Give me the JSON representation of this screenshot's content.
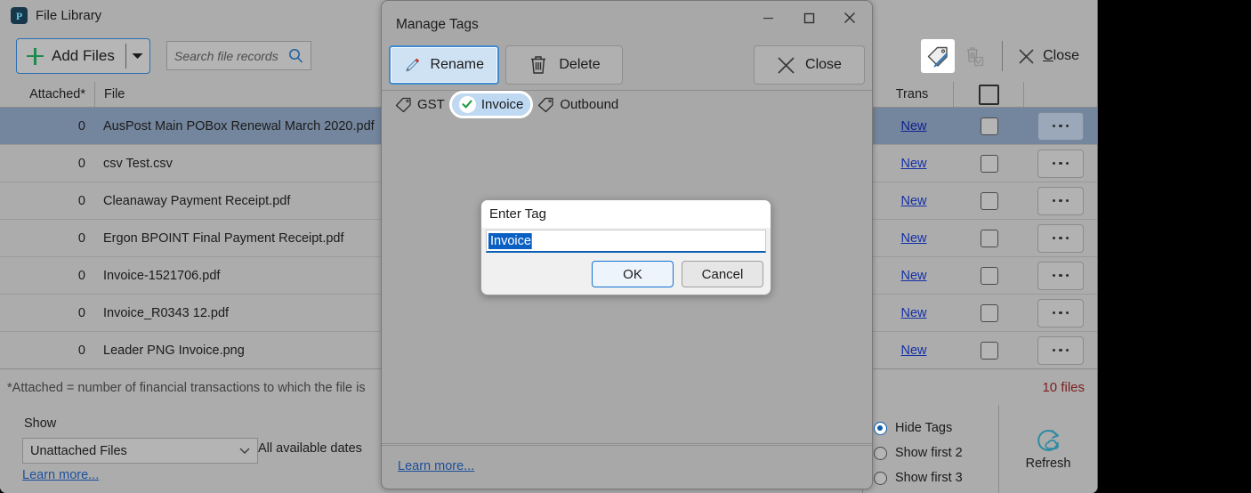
{
  "app": {
    "title": "File Library",
    "logo_icon": "app-logo-icon",
    "window_controls": {
      "minimize": "minimize-icon",
      "maximize": "maximize-icon",
      "close": "close-icon"
    },
    "toolbar": {
      "add_files_label": "Add Files",
      "add_files_plus_icon": "plus-icon",
      "add_files_caret_icon": "chevron-down-icon",
      "search_placeholder": "Search file records",
      "search_value": "",
      "search_icon": "search-icon",
      "manage_tags_icon": "tag-edit-icon",
      "delete_tagged_icon": "trash-checkbox-icon",
      "close_label_prefix": "C",
      "close_label_rest": "lose",
      "close_icon": "close-x-icon"
    },
    "grid": {
      "columns": [
        "Attached*",
        "File",
        "",
        "Trans",
        "",
        ""
      ],
      "sort_icon": "sort-ascending-icon",
      "select_all_checkbox": "select-all-checkbox",
      "rows": [
        {
          "attached": "0",
          "file": "AusPost Main POBox Renewal March 2020.pdf",
          "trans": "New",
          "selected": true
        },
        {
          "attached": "0",
          "file": "csv Test.csv",
          "trans": "New",
          "selected": false
        },
        {
          "attached": "0",
          "file": "Cleanaway Payment Receipt.pdf",
          "trans": "New",
          "selected": false
        },
        {
          "attached": "0",
          "file": "Ergon BPOINT Final Payment Receipt.pdf",
          "trans": "New",
          "selected": false
        },
        {
          "attached": "0",
          "file": "Invoice-1521706.pdf",
          "trans": "New",
          "selected": false
        },
        {
          "attached": "0",
          "file": "Invoice_R0343 12.pdf",
          "trans": "New",
          "selected": false
        },
        {
          "attached": "0",
          "file": "Leader PNG Invoice.png",
          "trans": "New",
          "selected": false
        }
      ]
    },
    "footnote": {
      "text": "*Attached = number of financial transactions to which the file is",
      "file_count": "10 files"
    },
    "bottom": {
      "show_label": "Show",
      "show_value": "Unattached Files",
      "show_caret_icon": "chevron-down-icon",
      "date_filter": "All available dates",
      "learn_more": "Learn more...",
      "tag_display_options": [
        {
          "label": "Hide Tags",
          "selected": true
        },
        {
          "label": "Show first 2",
          "selected": false
        },
        {
          "label": "Show first 3",
          "selected": false
        }
      ],
      "refresh_label": "Refresh",
      "refresh_icon": "refresh-cloud-icon"
    }
  },
  "dialog": {
    "title": "Manage Tags",
    "window_controls": {
      "minimize": "minimize-icon",
      "maximize": "maximize-icon",
      "close": "close-icon"
    },
    "buttons": {
      "rename_label": "Rename",
      "rename_icon": "pencil-icon",
      "delete_label": "Delete",
      "delete_icon": "trash-icon",
      "close_label": "Close",
      "close_icon": "close-x-icon"
    },
    "tags": [
      {
        "label": "GST",
        "selected": false,
        "icon": "tag-icon"
      },
      {
        "label": "Invoice",
        "selected": true,
        "icon": "check-icon"
      },
      {
        "label": "Outbound",
        "selected": false,
        "icon": "tag-icon"
      }
    ],
    "learn_more": "Learn more..."
  },
  "subdialog": {
    "title": "Enter Tag",
    "input_value": "Invoice",
    "ok_label": "OK",
    "cancel_label": "Cancel"
  },
  "colors": {
    "window_bg": "#acacac",
    "dialog_bg": "#a8a8a8",
    "row_selected": "#74869e",
    "link": "#1430a8",
    "accent_blue": "#0a60c2",
    "focus_blue": "#3f8ad0",
    "tag_selected_bg": "#bfd9f2",
    "file_count": "#7d2020",
    "plus_green": "#1d8a4e",
    "refresh_teal": "#2b8ca3"
  }
}
